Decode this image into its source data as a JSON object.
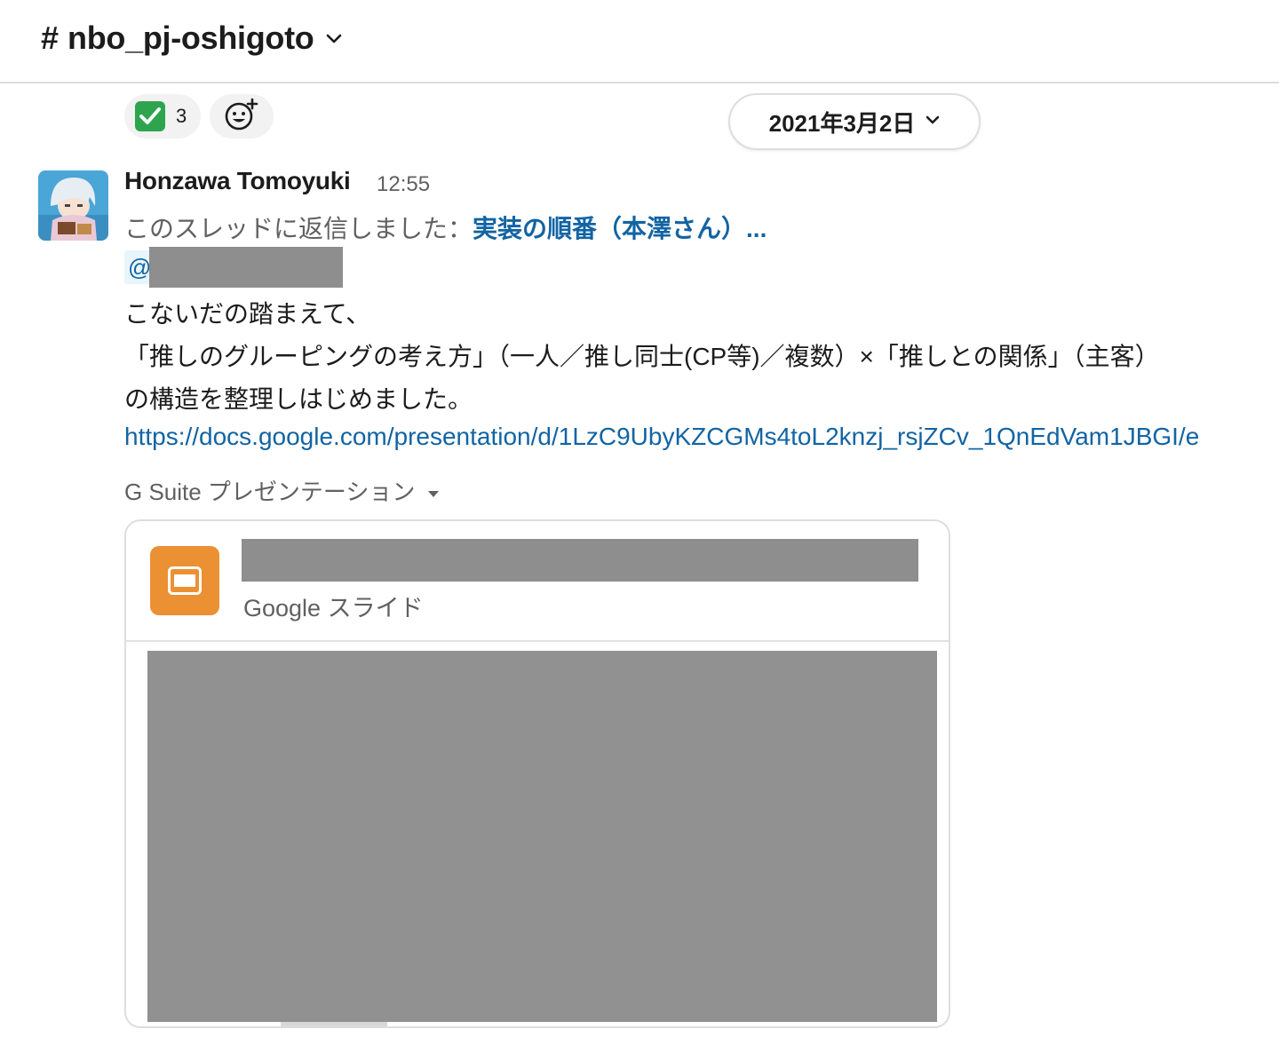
{
  "header": {
    "hash": "#",
    "channel_name": "nbo_pj-oshigoto",
    "dropdown_icon": "chevron-down-icon"
  },
  "reactions": [
    {
      "emoji": "white-check-mark-icon",
      "count": "3"
    },
    {
      "emoji": "add-reaction-icon"
    }
  ],
  "date_divider": {
    "label": "2021年3月2日",
    "icon": "chevron-down-icon"
  },
  "message": {
    "sender": "Honzawa Tomoyuki",
    "time": "12:55",
    "thread_prefix": "このスレッドに返信しました：",
    "thread_link": "実装の順番（本澤さん）...",
    "mention_at": "@",
    "lines": [
      "こないだの踏まえて、",
      "「推しのグルーピングの考え方」（一人／推し同士(CP等)／複数）×「推しとの関係」（主客）",
      "の構造を整理しはじめました。"
    ],
    "url": "https://docs.google.com/presentation/d/1LzC9UbyKZCGMs4toL2knzj_rsjZCv_1QnEdVam1JBGI/e",
    "attachment_source": "G Suite プレゼンテーション",
    "card": {
      "subtitle": "Google スライド",
      "icon": "google-slides-icon"
    }
  },
  "colors": {
    "link": "#1264a3",
    "slides_orange": "#eb9133",
    "redaction_gray": "#8e8e8e",
    "check_green": "#2ea44f"
  }
}
